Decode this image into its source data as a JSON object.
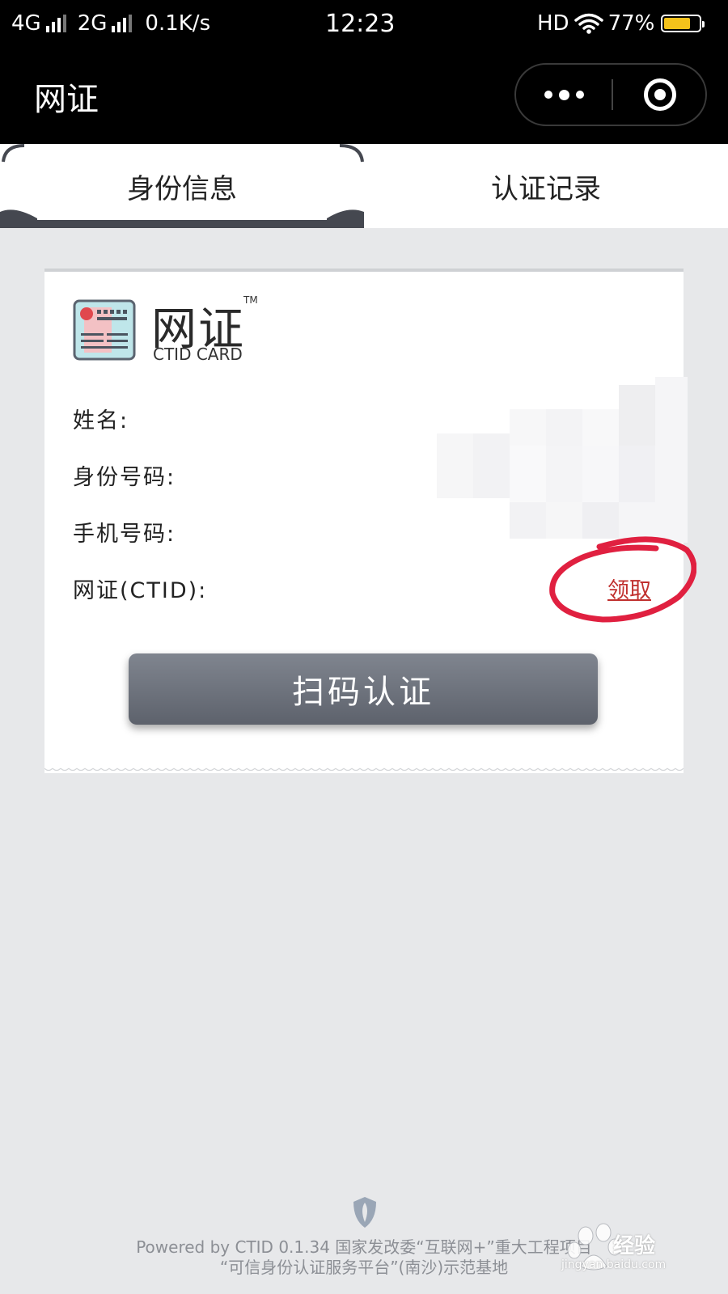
{
  "status_bar": {
    "sim1": "4G",
    "sim2": "2G",
    "speed": "0.1K/s",
    "time": "12:23",
    "hd": "HD",
    "battery": "77%",
    "battery_level": 0.77
  },
  "header": {
    "title": "网证"
  },
  "tabs": [
    {
      "label": "身份信息"
    },
    {
      "label": "认证记录"
    }
  ],
  "card": {
    "logo_cn": "网证",
    "logo_tm": "TM",
    "logo_en": "CTID CARD",
    "fields": [
      {
        "label": "姓名:"
      },
      {
        "label": "身份号码:"
      },
      {
        "label": "手机号码:"
      },
      {
        "label": "网证(CTID):"
      }
    ],
    "claim_link": "领取",
    "scan_button": "扫码认证"
  },
  "footer": {
    "line1": "Powered by CTID 0.1.34 国家发改委“互联网+”重大工程项目",
    "line2": "“可信身份认证服务平台”(南沙)示范基地"
  },
  "watermark": {
    "brand": "经验",
    "url": "jingyan.baidu.com"
  },
  "colors": {
    "header_bg": "#000000",
    "page_bg": "#e7e8ea",
    "button_bg": "#6b7079",
    "link": "#c0302e",
    "battery": "#f4c21b",
    "annotation": "#e02040"
  }
}
